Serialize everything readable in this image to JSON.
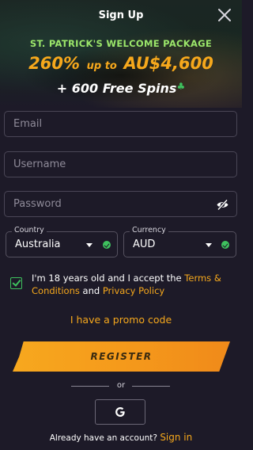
{
  "header": {
    "title": "Sign Up",
    "close_icon": "close-icon"
  },
  "banner": {
    "package_label": "ST. PATRICK'S WELCOME PACKAGE",
    "percent": "260%",
    "up_to": "up to",
    "amount": "AU$4,600",
    "spins": "+ 600 Free Spins",
    "spins_icon": "clover-icon"
  },
  "form": {
    "email": {
      "value": "",
      "placeholder": "Email"
    },
    "username": {
      "value": "",
      "placeholder": "Username"
    },
    "password": {
      "value": "",
      "placeholder": "Password",
      "toggle_icon": "eye-hidden-icon"
    },
    "country": {
      "label": "Country",
      "value": "Australia",
      "valid": true
    },
    "currency": {
      "label": "Currency",
      "value": "AUD",
      "valid": true
    }
  },
  "terms": {
    "checked": true,
    "text_prefix": "I'm 18 years old and I accept the ",
    "terms_link": "Terms & Conditions",
    "text_and": " and ",
    "privacy_link": "Privacy Policy"
  },
  "promo_code_link": "I have a promo code",
  "register_button": "REGISTER",
  "divider_text": "or",
  "social": {
    "google_label": "G",
    "google_icon": "google-icon"
  },
  "footer": {
    "prompt": "Already have an account? ",
    "signin_link": "Sign in"
  },
  "colors": {
    "background": "#1d1a28",
    "accent_orange": "#f6a81c",
    "accent_green": "#9be66a",
    "check_green": "#3ec25e"
  }
}
